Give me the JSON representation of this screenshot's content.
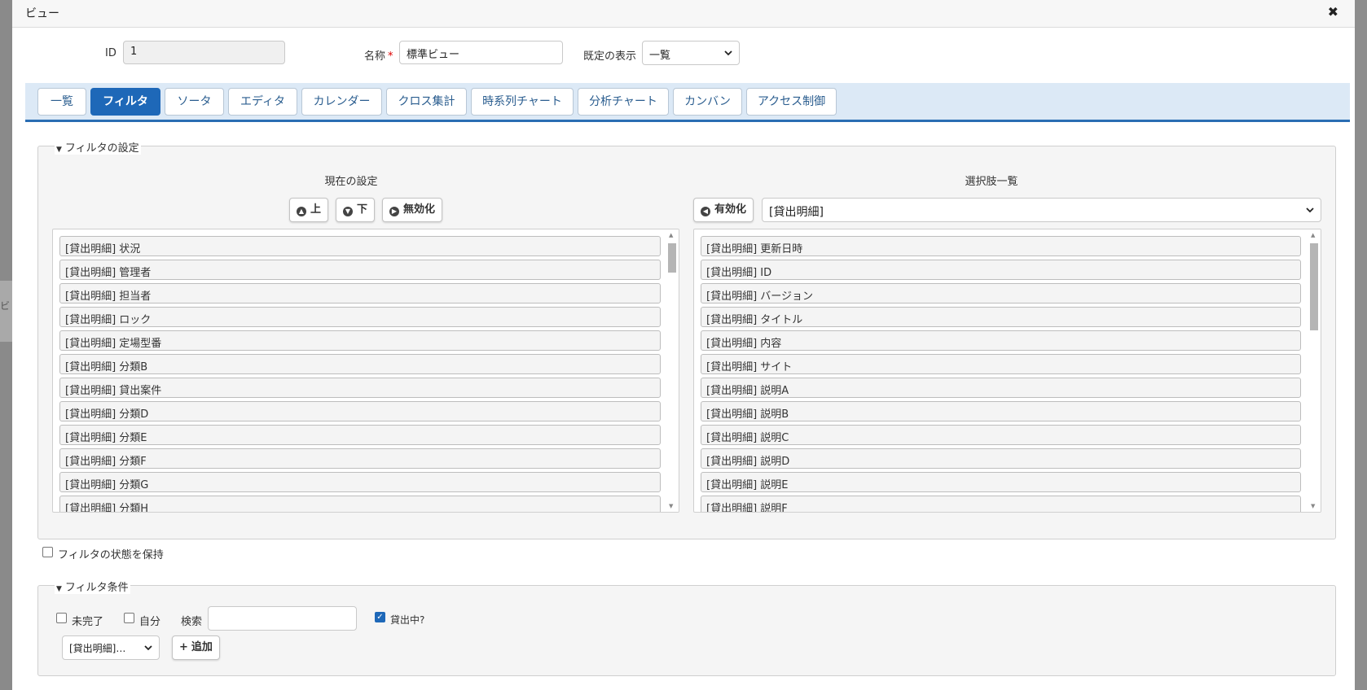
{
  "backdrop": {
    "ghost_text": "ビ"
  },
  "dialog": {
    "title": "ビュー",
    "close_glyph": "✖"
  },
  "form": {
    "id_label": "ID",
    "id_value": "1",
    "name_label": "名称",
    "required_mark": "*",
    "name_value": "標準ビュー",
    "default_display_label": "既定の表示",
    "default_display_value": "一覧"
  },
  "tabs": [
    {
      "label": "一覧"
    },
    {
      "label": "フィルタ",
      "active": true
    },
    {
      "label": "ソータ"
    },
    {
      "label": "エディタ"
    },
    {
      "label": "カレンダー"
    },
    {
      "label": "クロス集計"
    },
    {
      "label": "時系列チャート"
    },
    {
      "label": "分析チャート"
    },
    {
      "label": "カンバン"
    },
    {
      "label": "アクセス制御"
    }
  ],
  "filter_settings": {
    "legend": "フィルタの設定",
    "current_title": "現在の設定",
    "options_title": "選択肢一覧",
    "up_label": "上",
    "down_label": "下",
    "disable_label": "無効化",
    "enable_label": "有効化",
    "source_select_value": "[貸出明細]",
    "current_items": [
      "[貸出明細] 状況",
      "[貸出明細] 管理者",
      "[貸出明細] 担当者",
      "[貸出明細] ロック",
      "[貸出明細] 定場型番",
      "[貸出明細] 分類B",
      "[貸出明細] 貸出案件",
      "[貸出明細] 分類D",
      "[貸出明細] 分類E",
      "[貸出明細] 分類F",
      "[貸出明細] 分類G",
      "[貸出明細] 分類H"
    ],
    "option_items": [
      "[貸出明細] 更新日時",
      "[貸出明細] ID",
      "[貸出明細] バージョン",
      "[貸出明細] タイトル",
      "[貸出明細] 内容",
      "[貸出明細] サイト",
      "[貸出明細] 説明A",
      "[貸出明細] 説明B",
      "[貸出明細] 説明C",
      "[貸出明細] 説明D",
      "[貸出明細] 説明E",
      "[貸出明細] 説明F"
    ]
  },
  "keep_filter": {
    "label": "フィルタの状態を保持",
    "checked": false
  },
  "filter_conditions": {
    "legend": "フィルタ条件",
    "incomplete_label": "未完了",
    "incomplete_checked": false,
    "own_label": "自分",
    "own_checked": false,
    "search_label": "検索",
    "search_value": "",
    "lending_label": "貸出中?",
    "lending_checked": true,
    "column_select_value": "[貸出明細]…",
    "add_label": "追加"
  },
  "icons": {
    "up": "arrow-up-circle-icon",
    "down": "arrow-down-circle-icon",
    "disable": "arrow-right-circle-icon",
    "enable": "arrow-left-circle-icon",
    "add": "plus-icon",
    "close": "close-icon",
    "chevron": "chevron-down-icon"
  },
  "colors": {
    "accent": "#1e68b8",
    "tabbar_bg": "#dce9f6",
    "required": "#dd0000"
  }
}
